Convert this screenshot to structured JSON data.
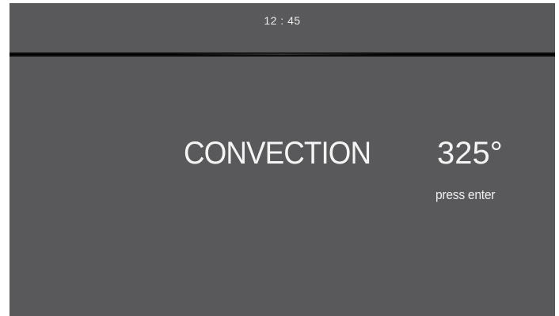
{
  "status_bar": {
    "time": "12 : 45"
  },
  "main": {
    "mode": "CONVECTION",
    "temperature": "325°",
    "hint": "press enter"
  },
  "colors": {
    "screen_background": "#59595b",
    "text": "#f4f4f4",
    "divider": "#000000"
  }
}
